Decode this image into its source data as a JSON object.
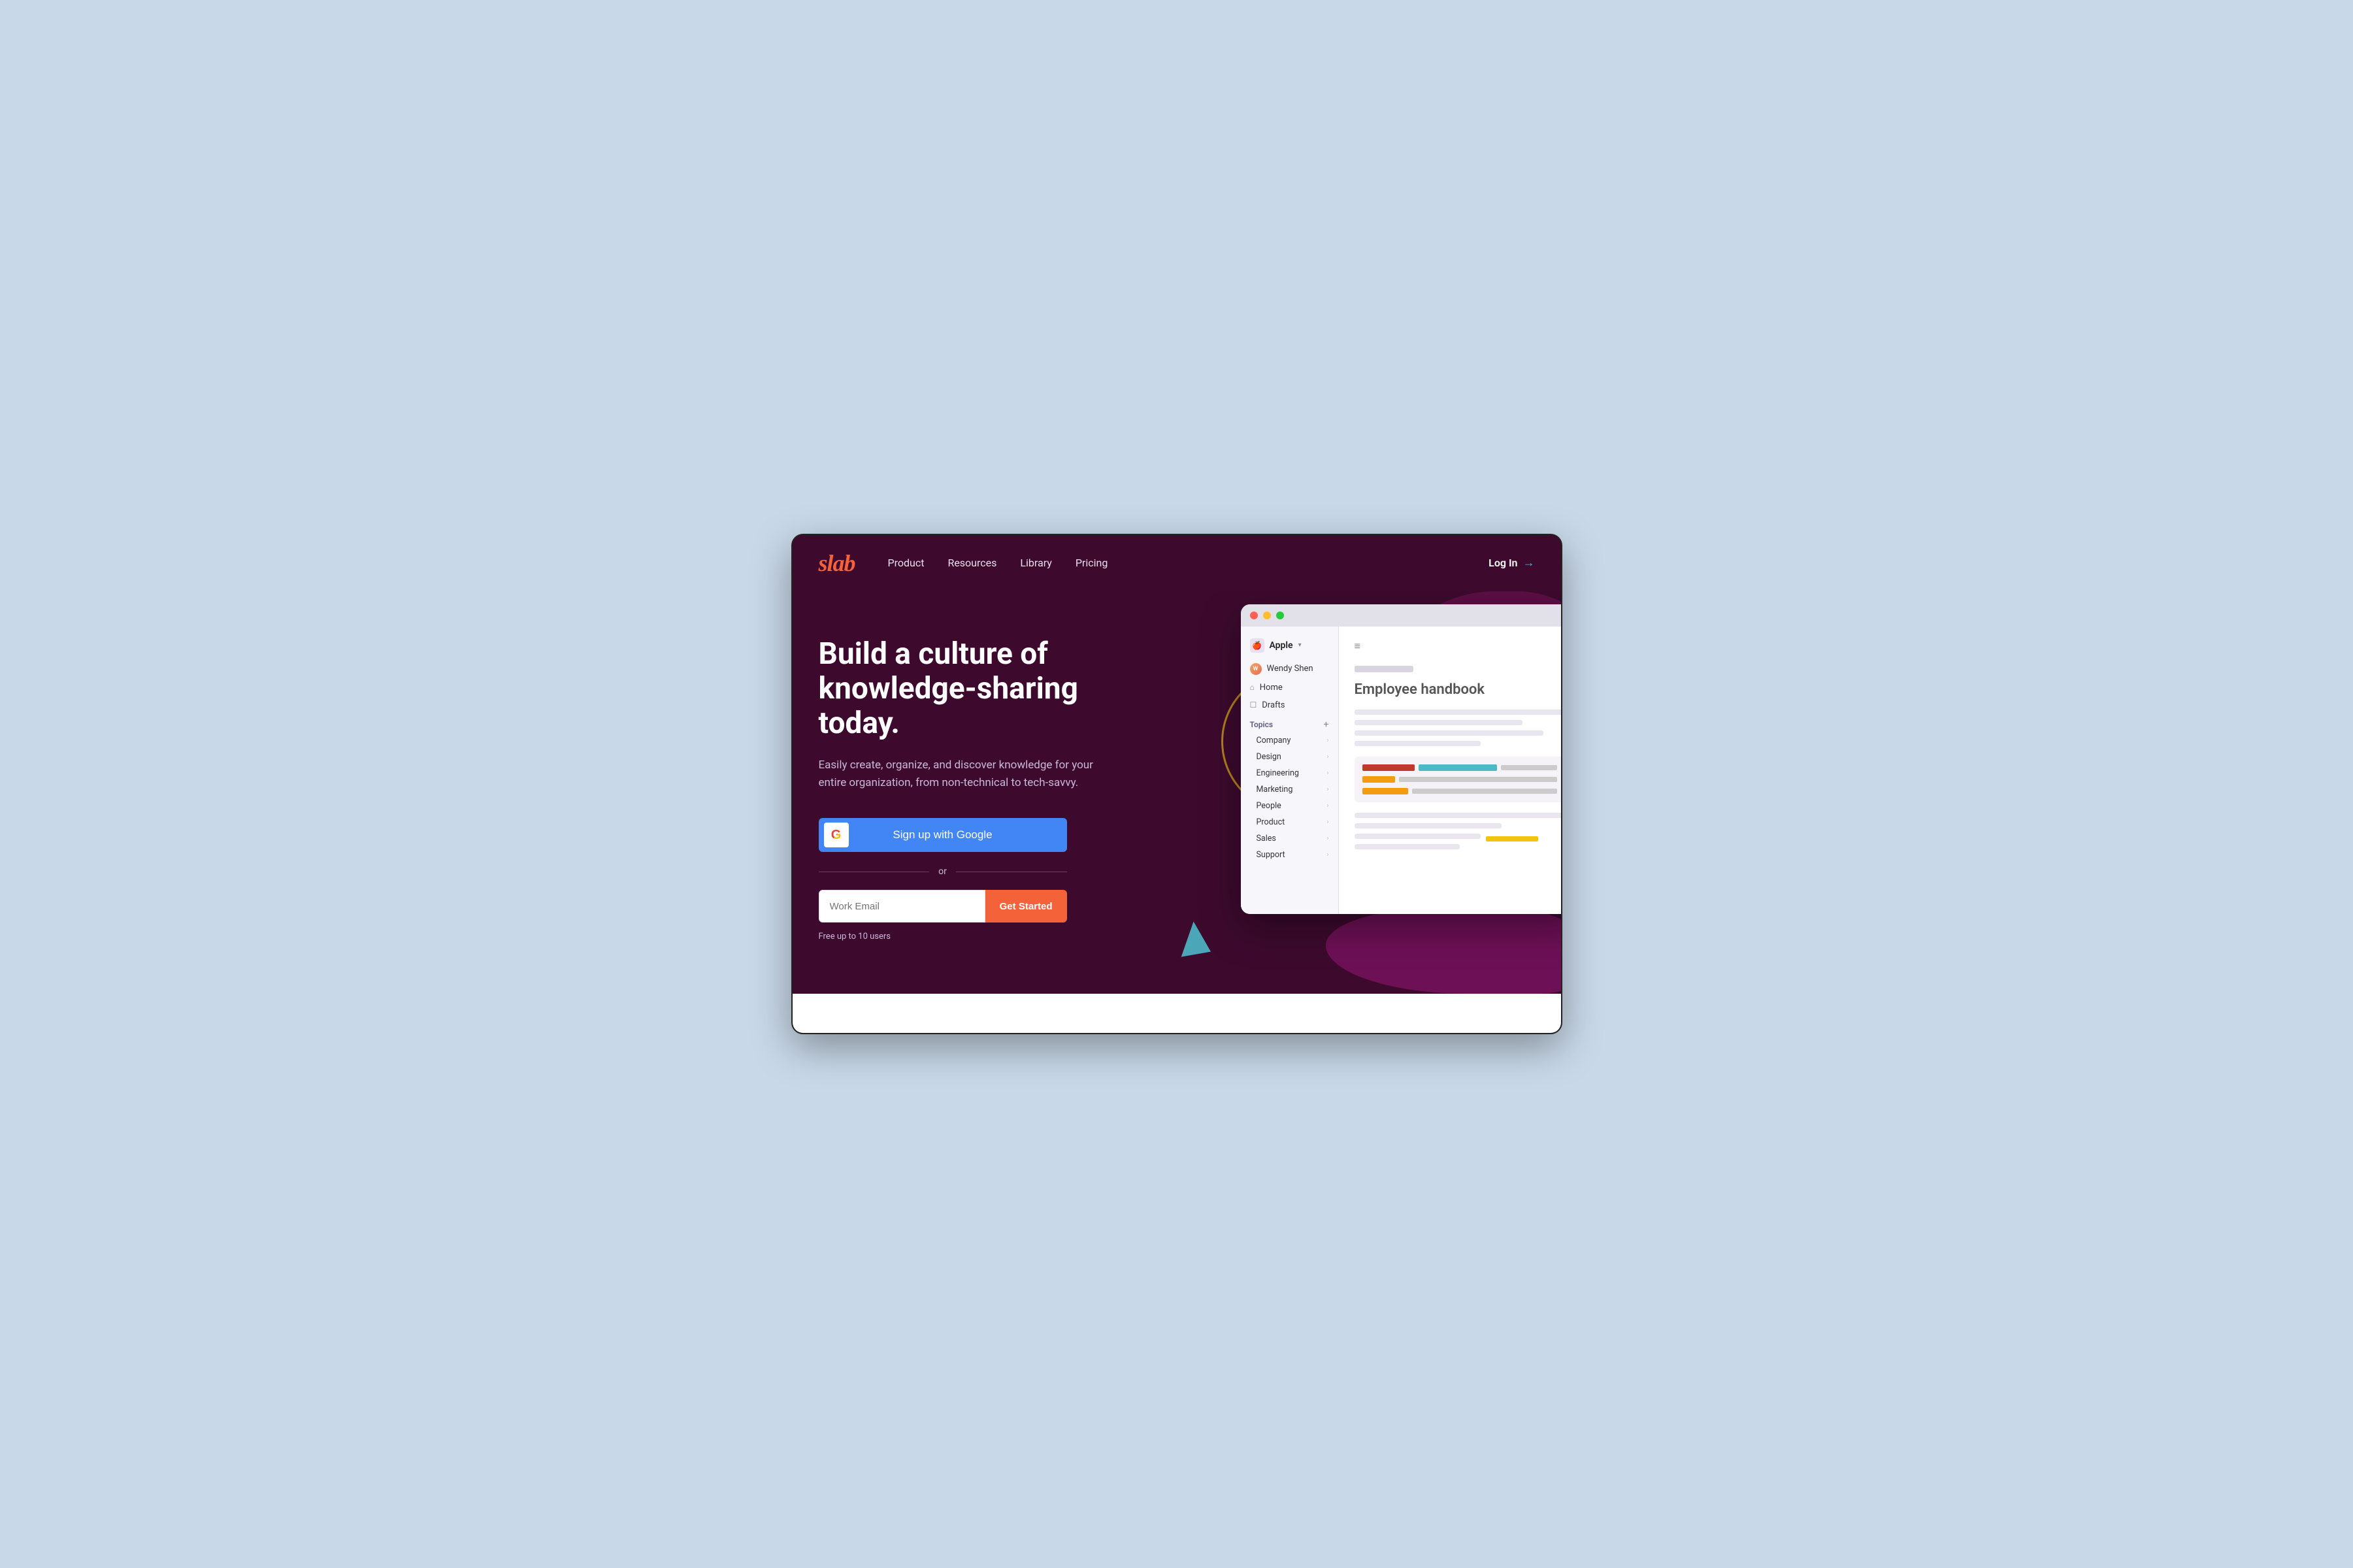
{
  "site": {
    "logo": "slab",
    "nav_links": [
      "Product",
      "Resources",
      "Library",
      "Pricing"
    ],
    "login_label": "Log In",
    "login_arrow": "→"
  },
  "hero": {
    "title": "Build a culture of knowledge-sharing today.",
    "subtitle": "Easily create, organize, and discover knowledge for your entire organization, from non-technical to tech-savvy.",
    "google_button_label": "Sign up with Google",
    "divider_text": "or",
    "email_placeholder": "Work Email",
    "get_started_label": "Get Started",
    "free_note": "Free up to 10 users"
  },
  "app_window": {
    "org_name": "Apple",
    "user_name": "Wendy Shen",
    "nav_home": "Home",
    "nav_drafts": "Drafts",
    "nav_topics": "Topics",
    "topics": [
      {
        "label": "Company"
      },
      {
        "label": "Design"
      },
      {
        "label": "Engineering"
      },
      {
        "label": "Marketing"
      },
      {
        "label": "People"
      },
      {
        "label": "Product"
      },
      {
        "label": "Sales"
      },
      {
        "label": "Support"
      }
    ],
    "doc_title": "Employee handbook"
  }
}
